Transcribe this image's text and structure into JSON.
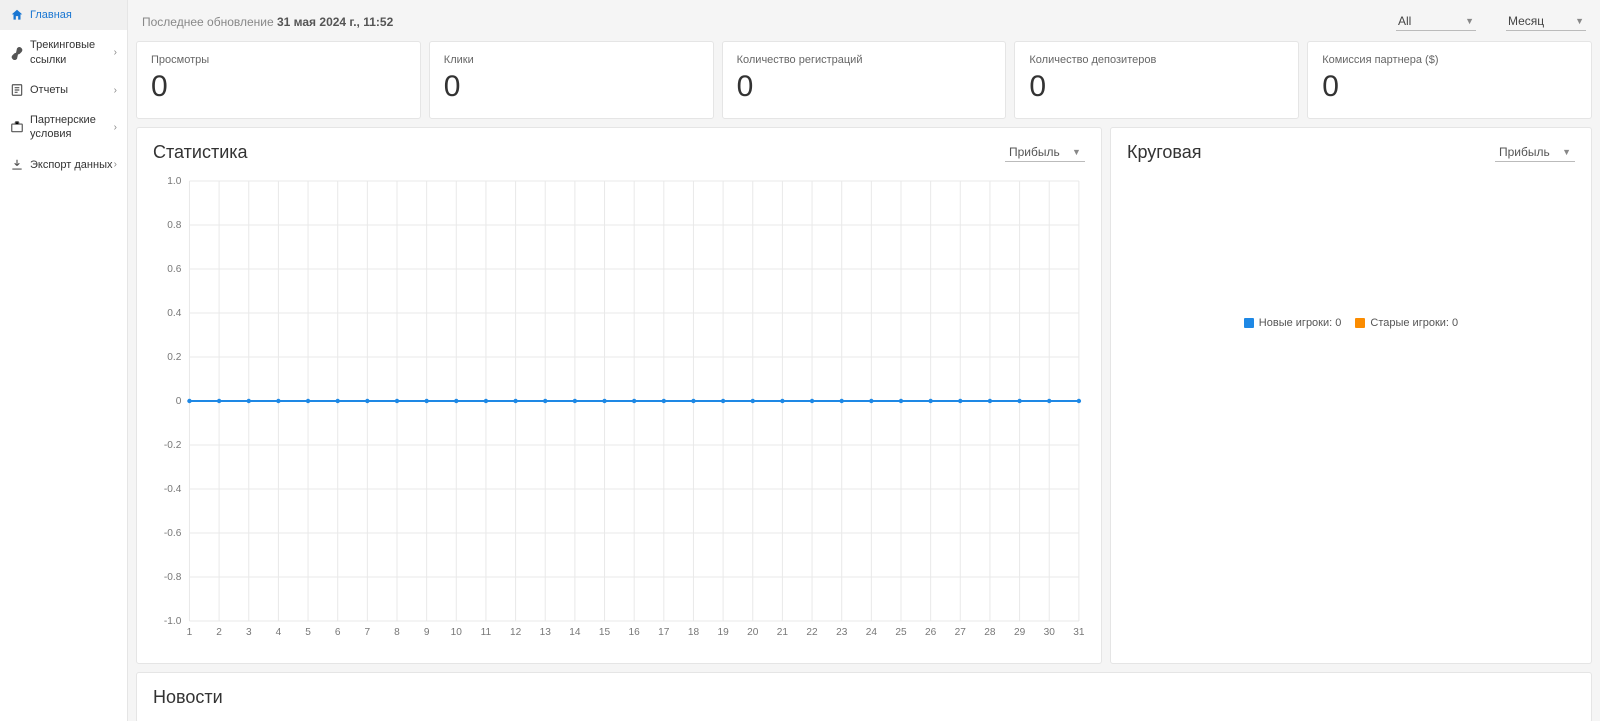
{
  "sidebar": {
    "items": [
      {
        "label": "Главная",
        "icon": "home-icon"
      },
      {
        "label": "Трекинговые ссылки",
        "icon": "link-icon"
      },
      {
        "label": "Отчеты",
        "icon": "report-icon"
      },
      {
        "label": "Партнерские условия",
        "icon": "briefcase-icon"
      },
      {
        "label": "Экспорт данных",
        "icon": "download-icon"
      }
    ]
  },
  "topbar": {
    "update_prefix": "Последнее обновление ",
    "update_value": "31 мая 2024 г., 11:52",
    "filter_all": "All",
    "filter_period": "Месяц"
  },
  "stats": [
    {
      "title": "Просмотры",
      "value": "0"
    },
    {
      "title": "Клики",
      "value": "0"
    },
    {
      "title": "Количество регистраций",
      "value": "0"
    },
    {
      "title": "Количество депозитеров",
      "value": "0"
    },
    {
      "title": "Комиссия партнера ($)",
      "value": "0"
    }
  ],
  "stats_panel": {
    "title": "Статистика",
    "select": "Прибыль"
  },
  "pie_panel": {
    "title": "Круговая",
    "select": "Прибыль",
    "legend": [
      {
        "label": "Новые игроки: 0",
        "color": "#1e88e5"
      },
      {
        "label": "Старые игроки: 0",
        "color": "#fb8c00"
      }
    ]
  },
  "news_panel": {
    "title": "Новости"
  },
  "chart_data": {
    "type": "line",
    "x": [
      1,
      2,
      3,
      4,
      5,
      6,
      7,
      8,
      9,
      10,
      11,
      12,
      13,
      14,
      15,
      16,
      17,
      18,
      19,
      20,
      21,
      22,
      23,
      24,
      25,
      26,
      27,
      28,
      29,
      30,
      31
    ],
    "series": [
      {
        "name": "Прибыль",
        "values": [
          0,
          0,
          0,
          0,
          0,
          0,
          0,
          0,
          0,
          0,
          0,
          0,
          0,
          0,
          0,
          0,
          0,
          0,
          0,
          0,
          0,
          0,
          0,
          0,
          0,
          0,
          0,
          0,
          0,
          0,
          0
        ],
        "color": "#1e88e5"
      }
    ],
    "ylim": [
      -1.0,
      1.0
    ],
    "yticks": [
      -1.0,
      -0.8,
      -0.6,
      -0.4,
      -0.2,
      0,
      0.2,
      0.4,
      0.6,
      0.8,
      1.0
    ],
    "ytick_labels": [
      "-1.0",
      "-0.8",
      "-0.6",
      "-0.4",
      "-0.2",
      "0",
      "0.2",
      "0.4",
      "0.6",
      "0.8",
      "1.0"
    ],
    "xlabel": "",
    "ylabel": ""
  }
}
